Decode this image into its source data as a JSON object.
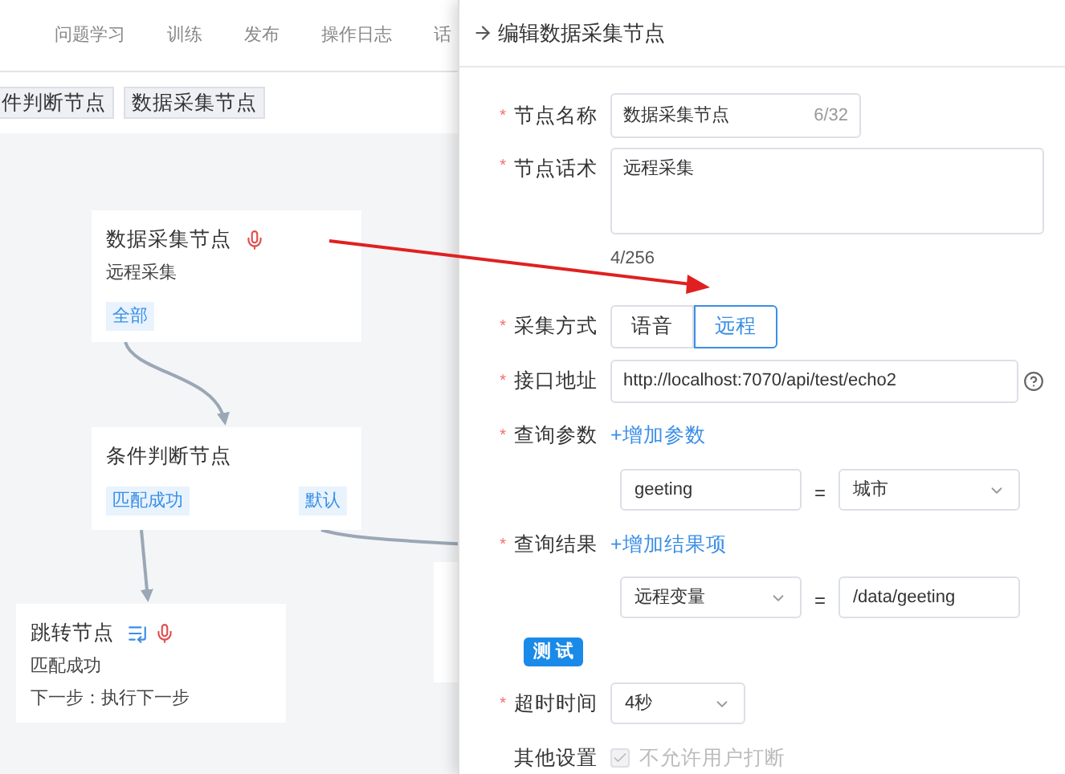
{
  "nav_tabs": [
    {
      "label": "问题学习"
    },
    {
      "label": "训练"
    },
    {
      "label": "发布"
    },
    {
      "label": "操作日志"
    },
    {
      "label": "话"
    }
  ],
  "toolbar_buttons": [
    {
      "label": "件判断节点"
    },
    {
      "label": "数据采集节点"
    }
  ],
  "nodes": [
    {
      "kind": "collect",
      "title": "数据采集节点",
      "lines": [
        "远程采集"
      ],
      "tags": [
        "全部"
      ]
    },
    {
      "kind": "condition",
      "title": "条件判断节点",
      "tags": [
        "匹配成功",
        "默认"
      ]
    },
    {
      "kind": "jump",
      "title": "跳转节点",
      "lines": [
        "匹配成功",
        "下一步：执行下一步"
      ]
    },
    {
      "kind": "partial"
    }
  ],
  "drawer": {
    "title": "编辑数据采集节点",
    "form": [
      {
        "kind": "input",
        "label": "节点名称",
        "required": "*",
        "value": "数据采集节点",
        "count": "6/32"
      },
      {
        "kind": "textarea",
        "label": "节点话术",
        "required": "*",
        "value": "远程采集",
        "count": "4/256"
      },
      {
        "kind": "segmented",
        "label": "采集方式",
        "required": "*",
        "options": [
          {
            "label": "语音",
            "selected": false
          },
          {
            "label": "远程",
            "selected": true
          }
        ]
      },
      {
        "kind": "url",
        "label": "接口地址",
        "required": "*",
        "value": "http://localhost:7070/api/test/echo2"
      },
      {
        "kind": "link",
        "label": "查询参数",
        "required": "*",
        "link": "+增加参数"
      },
      {
        "kind": "pair",
        "left": {
          "kind": "input",
          "value": "geeting"
        },
        "equals": "=",
        "right": {
          "kind": "select",
          "value": "城市"
        }
      },
      {
        "kind": "link",
        "label": "查询结果",
        "required": "*",
        "link": "+增加结果项"
      },
      {
        "kind": "pair",
        "left": {
          "kind": "select",
          "value": "远程变量"
        },
        "equals": "=",
        "right": {
          "kind": "input",
          "value": "/data/geeting"
        }
      },
      {
        "kind": "button",
        "label": "测 试"
      },
      {
        "kind": "select",
        "label": "超时时间",
        "required": "*",
        "value": "4秒"
      },
      {
        "kind": "checkbox",
        "label": "其他设置",
        "checked": true,
        "disabled": true,
        "text": "不允许用户打断"
      }
    ]
  }
}
